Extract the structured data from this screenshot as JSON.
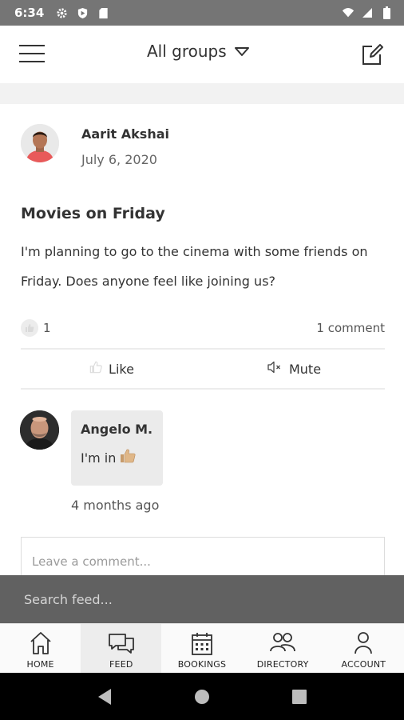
{
  "status_bar": {
    "time": "6:34",
    "icons": [
      "settings-icon",
      "shield-icon",
      "sd-card-icon",
      "wifi-icon",
      "signal-icon",
      "battery-icon"
    ]
  },
  "header": {
    "menu_icon": "hamburger-menu-icon",
    "group_selector": "All groups",
    "compose_icon": "compose-icon"
  },
  "post": {
    "author": "Aarit Akshai",
    "date": "July 6, 2020",
    "title": "Movies on Friday",
    "body": "I'm planning to go to the cinema with some friends on Friday. Does anyone feel like joining us?",
    "like_count": "1",
    "comment_count": "1 comment",
    "actions": {
      "like": "Like",
      "mute": "Mute"
    },
    "comments": [
      {
        "author": "Angelo M.",
        "text": "I'm in",
        "emoji": "👍",
        "time": "4 months ago"
      }
    ],
    "comment_placeholder": "Leave a comment..."
  },
  "search": {
    "placeholder": "Search feed..."
  },
  "bottom_nav": {
    "items": [
      {
        "label": "HOME",
        "icon": "home-icon",
        "active": false
      },
      {
        "label": "FEED",
        "icon": "feed-icon",
        "active": true
      },
      {
        "label": "BOOKINGS",
        "icon": "calendar-icon",
        "active": false
      },
      {
        "label": "DIRECTORY",
        "icon": "people-icon",
        "active": false
      },
      {
        "label": "ACCOUNT",
        "icon": "account-icon",
        "active": false
      }
    ]
  },
  "colors": {
    "status_bar": "#757575",
    "search_bar": "#616161",
    "comment_bubble": "#ebebeb",
    "nav_active": "#ededed"
  }
}
